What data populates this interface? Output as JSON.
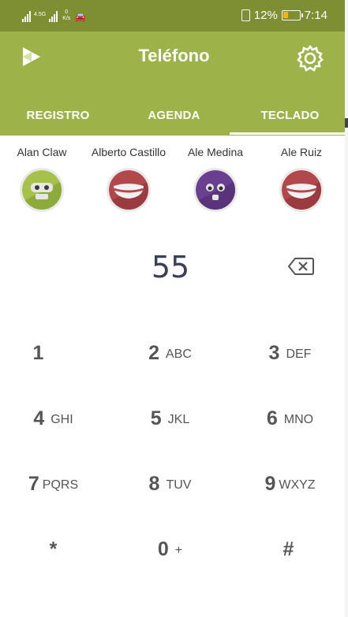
{
  "status_bar": {
    "network_label": "4.5G",
    "speed_value": "0",
    "speed_unit": "K/s",
    "battery_percent": "12%",
    "time": "7:14",
    "battery_fill_color": "#f3b321"
  },
  "app_bar": {
    "title": "Teléfono",
    "logo_icon": "play-triangles-logo-icon",
    "settings_icon": "gear-icon",
    "color": "#9db34a"
  },
  "tabs": [
    {
      "label": "REGISTRO",
      "selected": false
    },
    {
      "label": "AGENDA",
      "selected": false
    },
    {
      "label": "TECLADO",
      "selected": true
    }
  ],
  "contacts": [
    {
      "name": "Alan Claw",
      "avatar_color": "#a6c24a"
    },
    {
      "name": "Alberto Castillo",
      "avatar_color": "#b2484b"
    },
    {
      "name": "Ale Medina",
      "avatar_color": "#6b3f8f"
    },
    {
      "name": "Ale Ruiz",
      "avatar_color": "#b2484b"
    }
  ],
  "dialer": {
    "number": "55",
    "backspace_icon": "backspace-icon"
  },
  "keypad": [
    {
      "digit": "1",
      "letters": ""
    },
    {
      "digit": "2",
      "letters": "ABC"
    },
    {
      "digit": "3",
      "letters": "DEF"
    },
    {
      "digit": "4",
      "letters": "GHI"
    },
    {
      "digit": "5",
      "letters": "JKL"
    },
    {
      "digit": "6",
      "letters": "MNO"
    },
    {
      "digit": "7",
      "letters": "PQRS"
    },
    {
      "digit": "8",
      "letters": "TUV"
    },
    {
      "digit": "9",
      "letters": "WXYZ"
    },
    {
      "digit": "*",
      "letters": ""
    },
    {
      "digit": "0",
      "letters": "+"
    },
    {
      "digit": "#",
      "letters": ""
    }
  ]
}
